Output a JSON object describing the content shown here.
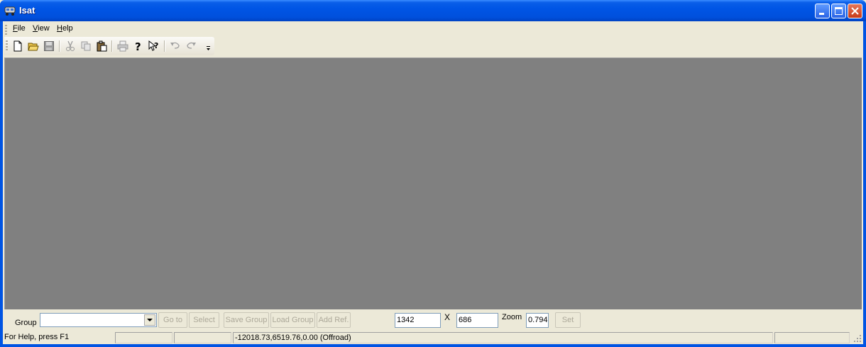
{
  "window": {
    "title": "Isat",
    "icon": "app-icon",
    "controls": [
      "minimize-icon",
      "maximize-icon",
      "close-icon"
    ]
  },
  "menu": {
    "file": {
      "accel": "F",
      "rest": "ile"
    },
    "view": {
      "accel": "V",
      "rest": "iew"
    },
    "help": {
      "accel": "H",
      "rest": "elp"
    }
  },
  "toolbar": {
    "buttons": [
      "new-file-icon",
      "open-folder-icon",
      "save-icon",
      "cut-icon",
      "copy-icon",
      "paste-icon",
      "print-icon",
      "help-icon",
      "context-help-icon",
      "undo-icon",
      "redo-icon",
      "toolbar-options-icon"
    ]
  },
  "controls": {
    "group_label": "Group",
    "group_value": "",
    "goto_label": "Go to",
    "select_label": "Select",
    "save_group_label": "Save Group",
    "load_group_label": "Load Group",
    "add_ref_label": "Add Ref.",
    "width_value": "1342",
    "x_label": "X",
    "height_value": "686",
    "zoom_label": "Zoom",
    "zoom_value": "0.794",
    "set_label": "Set"
  },
  "status": {
    "help_text": "For Help, press F1",
    "pane2": "",
    "pane3": "",
    "coords": "-12018.73,6519.76,0.00 (Offroad)",
    "pane5": ""
  }
}
